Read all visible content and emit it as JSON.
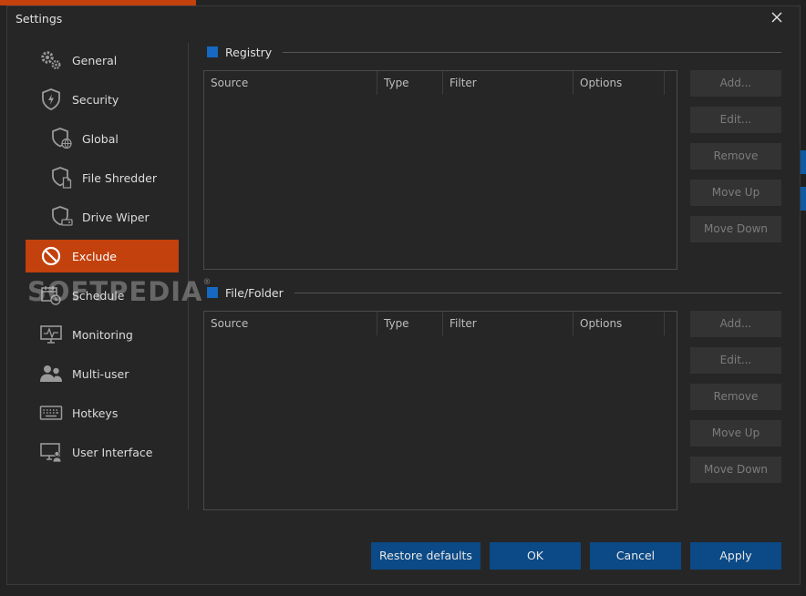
{
  "dialog": {
    "title": "Settings",
    "close_symbol": "✕"
  },
  "sidebar": {
    "items": [
      {
        "label": "General",
        "icon": "gears-icon"
      },
      {
        "label": "Security",
        "icon": "shield-bolt-icon"
      },
      {
        "label": "Global",
        "icon": "shield-globe-icon"
      },
      {
        "label": "File Shredder",
        "icon": "shield-file-icon"
      },
      {
        "label": "Drive Wiper",
        "icon": "shield-drive-icon"
      },
      {
        "label": "Exclude",
        "icon": "prohibited-icon"
      },
      {
        "label": "Schedule",
        "icon": "calendar-clock-icon"
      },
      {
        "label": "Monitoring",
        "icon": "monitor-pulse-icon"
      },
      {
        "label": "Multi-user",
        "icon": "users-icon"
      },
      {
        "label": "Hotkeys",
        "icon": "keyboard-icon"
      },
      {
        "label": "User Interface",
        "icon": "monitor-user-icon"
      }
    ],
    "active": "Exclude"
  },
  "watermark": {
    "text": "SOFTPEDIA",
    "mark": "®"
  },
  "registry": {
    "title": "Registry",
    "columns": [
      "Source",
      "Type",
      "Filter",
      "Options"
    ],
    "buttons": [
      "Add...",
      "Edit...",
      "Remove",
      "Move Up",
      "Move Down"
    ]
  },
  "filefolder": {
    "title": "File/Folder",
    "columns": [
      "Source",
      "Type",
      "Filter",
      "Options"
    ],
    "buttons": [
      "Add...",
      "Edit...",
      "Remove",
      "Move Up",
      "Move Down"
    ]
  },
  "footer": {
    "restore": "Restore defaults",
    "ok": "OK",
    "cancel": "Cancel",
    "apply": "Apply"
  },
  "colors": {
    "accent": "#c2410c",
    "primary_button": "#0b4a86",
    "section_marker": "#1668c0",
    "background": "#262626"
  }
}
